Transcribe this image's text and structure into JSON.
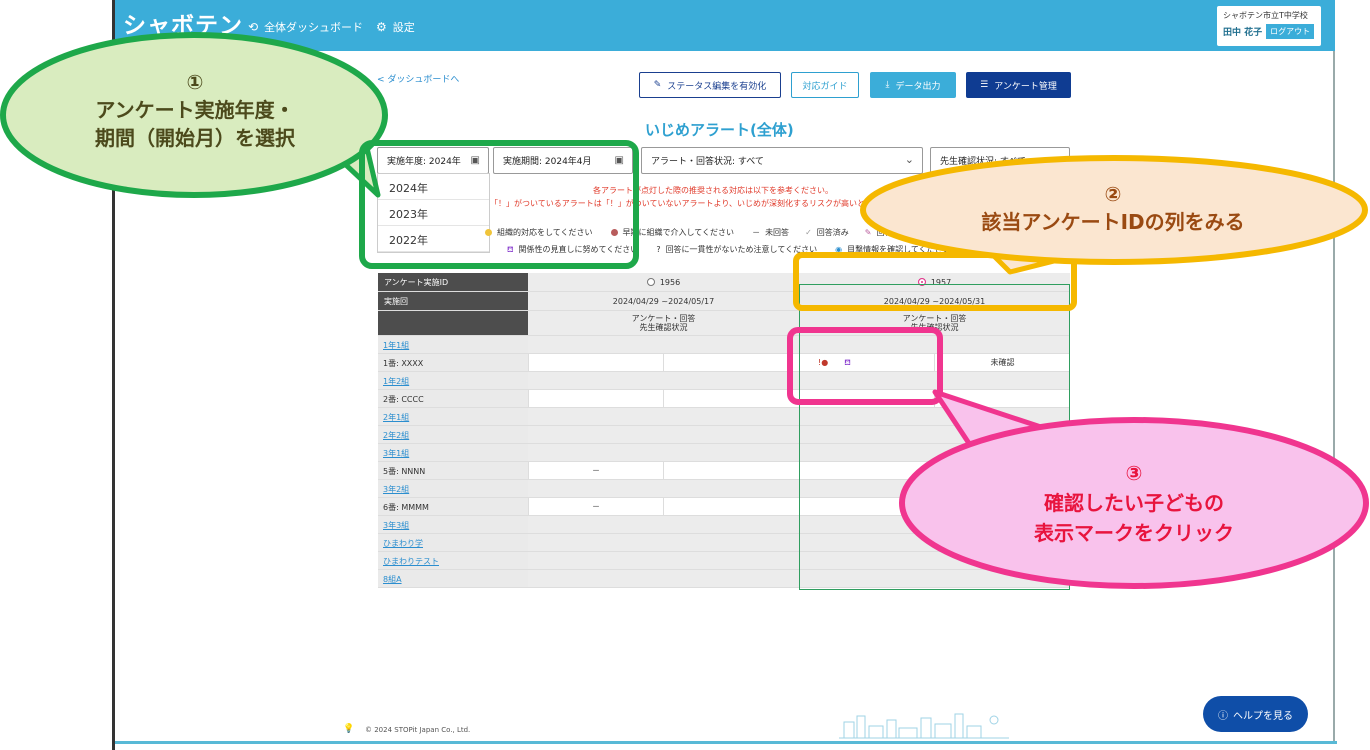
{
  "app": {
    "logo": "シャボテン",
    "nav": [
      {
        "label": "全体ダッシュボード",
        "icon": "refresh-icon"
      },
      {
        "label": "設定",
        "icon": "gear-icon"
      }
    ],
    "user": {
      "school": "シャボテン市立T中学校",
      "name": "田中 花子",
      "logout": "ログアウト"
    }
  },
  "toolbar": {
    "back": "< ダッシュボードへ",
    "edit_status": "ステータス編集を有効化",
    "guide": "対応ガイド",
    "export": "データ出力",
    "survey_manage": "アンケート管理"
  },
  "page_title": "いじめアラート(全体)",
  "filters": {
    "year": "実施年度: 2024年",
    "period": "実施期間: 2024年4月",
    "alert_status": "アラート・回答状況: すべて",
    "teacher_status": "先生確認状況: すべて"
  },
  "year_options": [
    "2024年",
    "2023年",
    "2022年"
  ],
  "notice": {
    "line1": "各アラートが点灯した際の推奨される対応は以下を参考ください。",
    "line2": "「！」がついているアラートは「！」がついていないアラートより、いじめが深刻化するリスクが高いと想定されます。"
  },
  "legend": {
    "row1": [
      "組織的対応をしてください",
      "早期に組織で介入してください",
      "未回答",
      "回答済み",
      "回答"
    ],
    "row2": [
      "関係性の見直しに努めてください",
      "回答に一貫性がないため注意してください",
      "目撃情報を確認してください"
    ],
    "dash": "－"
  },
  "table": {
    "header_id": "アンケート実施ID",
    "header_round": "実施回",
    "surveys": [
      {
        "id": "1956",
        "period": "2024/04/29 ~2024/05/17",
        "sub1": "アンケート・回答",
        "sub2": "先生確認状況",
        "selected": false
      },
      {
        "id": "1957",
        "period": "2024/04/29 ~2024/05/31",
        "sub1": "アンケート・回答",
        "sub2": "先生確認状況",
        "selected": true
      }
    ],
    "rows": [
      {
        "label": "1年1組",
        "type": "class"
      },
      {
        "label": "1番: XXXX",
        "type": "student",
        "c1": "",
        "c2": "",
        "c3": "!●",
        "c4": "未確認"
      },
      {
        "label": "1年2組",
        "type": "class"
      },
      {
        "label": "2番: CCCC",
        "type": "student",
        "c1": "",
        "c2": "",
        "c3": "",
        "c4": ""
      },
      {
        "label": "2年1組",
        "type": "class"
      },
      {
        "label": "2年2組",
        "type": "class"
      },
      {
        "label": "3年1組",
        "type": "class"
      },
      {
        "label": "5番: NNNN",
        "type": "student",
        "c1": "－",
        "c2": "",
        "c3": "",
        "c4": ""
      },
      {
        "label": "3年2組",
        "type": "class"
      },
      {
        "label": "6番: MMMM",
        "type": "student",
        "c1": "－",
        "c2": "",
        "c3": "",
        "c4": ""
      },
      {
        "label": "3年3組",
        "type": "class"
      },
      {
        "label": "ひまわり学",
        "type": "class"
      },
      {
        "label": "ひまわりテスト",
        "type": "class"
      },
      {
        "label": "8組A",
        "type": "class"
      }
    ]
  },
  "footer": {
    "copyright": "© 2024 STOPit Japan Co., Ltd.",
    "help": "ヘルプを見る"
  },
  "callouts": {
    "c1_num": "①",
    "c1_line1": "アンケート実施年度・",
    "c1_line2": "期間（開始月）を選択",
    "c2_num": "②",
    "c2_line1": "該当アンケートIDの列をみる",
    "c3_num": "③",
    "c3_line1": "確認したい子どもの",
    "c3_line2": "表示マークをクリック"
  },
  "colors": {
    "header": "#3badd9",
    "green": "#1ea84a",
    "yellow": "#f5b800",
    "pink": "#f0358f",
    "navy": "#0f3c92"
  }
}
